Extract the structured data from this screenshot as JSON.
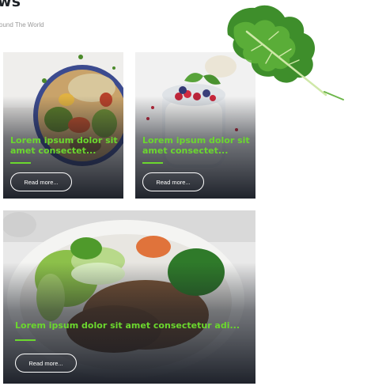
{
  "section": {
    "heading": "ws",
    "subheading": "ound The World"
  },
  "cards": [
    {
      "title": "Lorem ipsum dolor sit amet consectet...",
      "button_label": "Read more..."
    },
    {
      "title": "Lorem ipsum dolor sit amet consectet...",
      "button_label": "Read more..."
    },
    {
      "title": "Lorem ipsum dolor sit amet consectetur adi...",
      "button_label": "Read more..."
    }
  ],
  "colors": {
    "accent": "#6bd82e",
    "heading": "#1f2328",
    "subheading": "#9a9a9a",
    "card_bg": "#2b2f38"
  },
  "icons": {
    "decoration": "kale-leaf-icon"
  }
}
